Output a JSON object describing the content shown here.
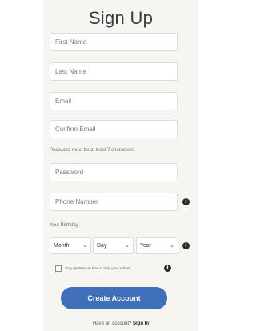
{
  "form": {
    "title": "Sign Up",
    "first_name_placeholder": "First Name",
    "last_name_placeholder": "Last Name",
    "email_placeholder": "Email",
    "confirm_email_placeholder": "Confirm Email",
    "password_hint": "Password must be at least 7 characters",
    "password_placeholder": "Password",
    "phone_placeholder": "Phone Number",
    "birthday_label": "Your Birthday",
    "month_selected": "Month",
    "day_selected": "Day",
    "year_selected": "Year",
    "checkbox_label": "Stay updated on how to help your school",
    "submit_label": "Create Account",
    "signin_prompt": "Have an account?",
    "signin_link": "Sign In"
  },
  "icons": {
    "info": "info-icon",
    "chevron": "chevron-down-icon"
  },
  "colors": {
    "panel_bg": "#f6f5f2",
    "button_bg": "#3e6fb8",
    "button_text": "#ffffff"
  }
}
